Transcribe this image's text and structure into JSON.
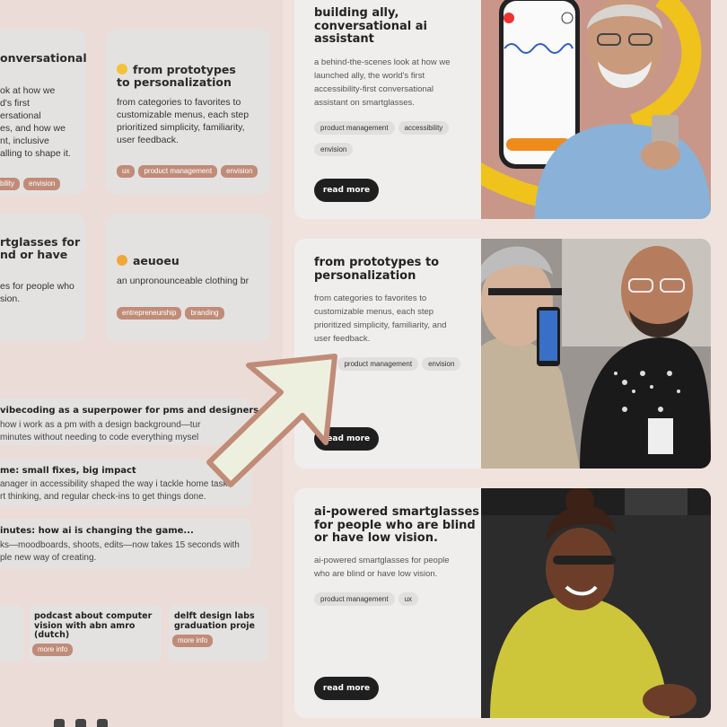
{
  "background_page": {
    "cards": [
      {
        "title": "onversational",
        "body": [
          "ok at how we",
          "d's first",
          "ersational",
          "es, and how we",
          "nt, inclusive",
          "alling to shape it."
        ],
        "chips": [
          "bility",
          "envision"
        ]
      },
      {
        "title": "from prototypes to personalization",
        "emoji": "smile-emoji",
        "body": [
          "from categories to favorites to",
          "customizable menus, each step",
          "prioritized simplicity, familiarity,",
          "user feedback."
        ],
        "chips": [
          "ux",
          "product management",
          "envision"
        ]
      },
      {
        "title": "rtglasses for",
        "title2": "nd or have",
        "body": [
          "es for people who",
          "sion."
        ],
        "chips": []
      },
      {
        "title": "aeuoeu",
        "emoji": "cat-emoji",
        "body": [
          "an unpronounceable clothing br"
        ],
        "chips": [
          "entrepreneurship",
          "branding"
        ]
      }
    ],
    "rows": [
      {
        "title": "vibecoding as a superpower for pms and designers",
        "lines": [
          "how i work as a pm with a design background—tur",
          "minutes without needing to code everything mysel"
        ]
      },
      {
        "title": "me: small fixes, big impact",
        "lines": [
          "anager in accessibility shaped the way i tackle home tasks",
          "rt thinking, and regular check-ins to get things done."
        ]
      },
      {
        "title": "inutes: how ai is changing the game...",
        "lines": [
          "ks—moodboards, shoots, edits—now takes 15 seconds with",
          "ple new way of creating."
        ]
      }
    ],
    "small_cards": [
      {
        "title": [
          "podcast about computer",
          "vision with abn amro",
          "(dutch)"
        ],
        "button": "more info"
      },
      {
        "title": [
          "delft design labs",
          "graduation proje"
        ],
        "button": "more info"
      }
    ]
  },
  "posts": [
    {
      "title": [
        "building ally,",
        "conversational ai",
        "assistant"
      ],
      "body": [
        "a behind-the-scenes look at how we",
        "launched ally, the world's first",
        "accessibility-first conversational",
        "assistant on smartglasses."
      ],
      "tags": [
        "product management",
        "accessibility",
        "envision"
      ],
      "button": "read more"
    },
    {
      "title": [
        "from prototypes to",
        "personalization"
      ],
      "body": [
        "from categories to favorites to",
        "customizable menus, each step",
        "prioritized simplicity, familiarity, and",
        "user feedback."
      ],
      "tags": [
        "ux",
        "product management",
        "envision"
      ],
      "button": "read more"
    },
    {
      "title": [
        "ai-powered smartglasses",
        "for people who are blind",
        "or have low vision."
      ],
      "body": [
        "ai-powered smartglasses for people",
        "who are blind or have low vision."
      ],
      "tags": [
        "product management",
        "ux"
      ],
      "button": "read more"
    }
  ],
  "colors": {
    "page_bg": "#ecdcd7",
    "card_bg": "#efeeed",
    "chip_terracotta": "#c08c78",
    "button_dark": "#1f1f1f",
    "arrow_fill": "#eef0df",
    "arrow_stroke": "#c08c78"
  }
}
